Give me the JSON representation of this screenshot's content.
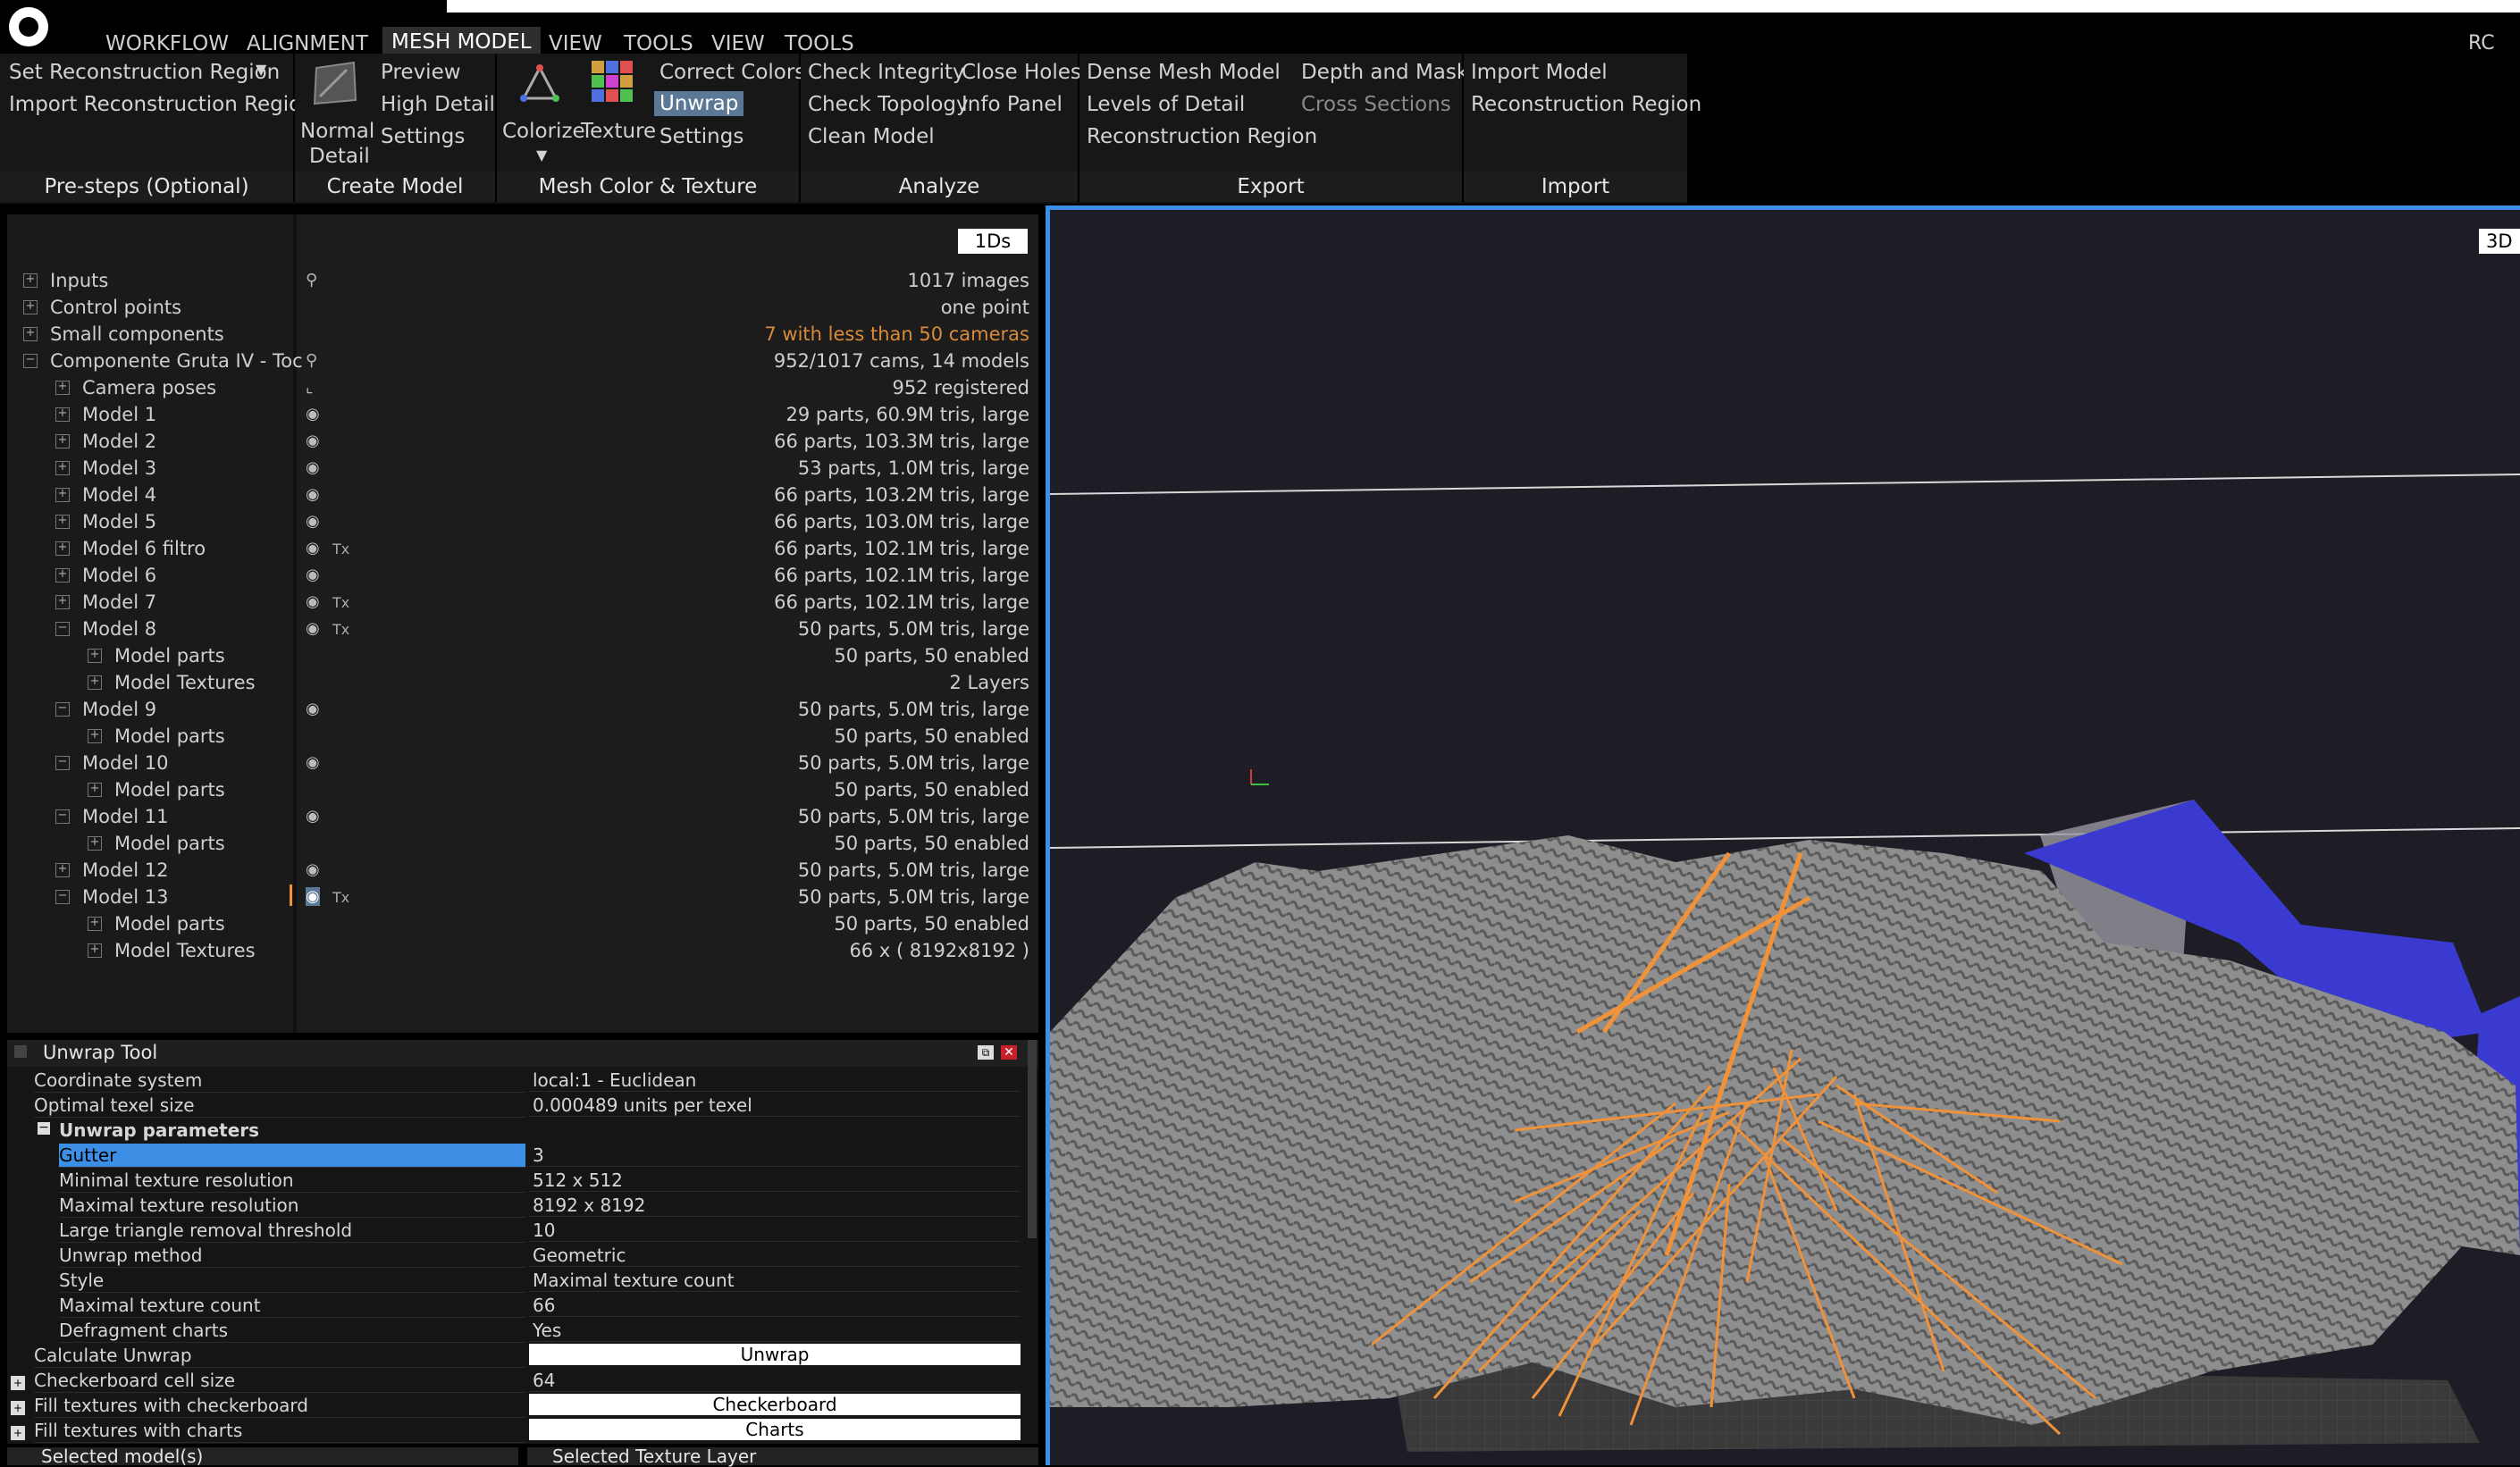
{
  "menubar": {
    "items": [
      "WORKFLOW",
      "ALIGNMENT",
      "MESH MODEL",
      "VIEW",
      "TOOLS",
      "VIEW",
      "TOOLS"
    ],
    "active": "MESH MODEL",
    "right_label": "RC"
  },
  "ribbon": {
    "presteps": {
      "line1": "Set Reconstruction Region",
      "line2": "Import Reconstruction Region",
      "footer": "Pre-steps (Optional)"
    },
    "create": {
      "normal": "Normal",
      "detail": "Detail",
      "preview": "Preview",
      "high_detail": "High Detail",
      "settings": "Settings",
      "footer": "Create Model"
    },
    "color": {
      "colorize": "Colorize",
      "texture": "Texture",
      "correct_colors": "Correct Colors",
      "unwrap": "Unwrap",
      "settings": "Settings",
      "footer": "Mesh Color & Texture"
    },
    "analyze": {
      "check_integrity": "Check Integrity",
      "close_holes": "Close Holes",
      "check_topology": "Check Topology",
      "info_panel": "Info Panel",
      "clean_model": "Clean Model",
      "footer": "Analyze"
    },
    "export": {
      "dense_mesh": "Dense Mesh Model",
      "depth_mask": "Depth and Mask",
      "lod": "Levels of Detail",
      "cross_sections": "Cross Sections",
      "recon_region": "Reconstruction Region",
      "footer": "Export"
    },
    "import": {
      "import_model": "Import Model",
      "recon_region": "Reconstruction Region",
      "footer": "Import"
    }
  },
  "tree": {
    "view_button": "1Ds",
    "rows": [
      {
        "label": "Inputs",
        "value": "1017 images"
      },
      {
        "label": "Control points",
        "value": "one point"
      },
      {
        "label": "Small components",
        "value": "7 with less than 50 cameras"
      },
      {
        "label": "Componente Gruta IV  - Toc",
        "value": "952/1017 cams, 14 models"
      },
      {
        "label": "Camera poses",
        "value": "952 registered"
      },
      {
        "label": "Model 1",
        "value": "29 parts, 60.9M tris, large"
      },
      {
        "label": "Model 2",
        "value": "66 parts, 103.3M tris, large"
      },
      {
        "label": "Model 3",
        "value": "53 parts, 1.0M tris, large"
      },
      {
        "label": "Model 4",
        "value": "66 parts, 103.2M tris, large"
      },
      {
        "label": "Model 5",
        "value": "66 parts, 103.0M tris, large"
      },
      {
        "label": "Model 6 filtro",
        "value": "66 parts, 102.1M tris, large"
      },
      {
        "label": "Model 6",
        "value": "66 parts, 102.1M tris, large"
      },
      {
        "label": "Model 7",
        "value": "66 parts, 102.1M tris, large"
      },
      {
        "label": "Model 8",
        "value": "50 parts, 5.0M tris, large"
      },
      {
        "label": "Model parts",
        "value": "50 parts, 50 enabled"
      },
      {
        "label": "Model Textures",
        "value": "2 Layers"
      },
      {
        "label": "Model 9",
        "value": "50 parts, 5.0M tris, large"
      },
      {
        "label": "Model parts",
        "value": "50 parts, 50 enabled"
      },
      {
        "label": "Model 10",
        "value": "50 parts, 5.0M tris, large"
      },
      {
        "label": "Model parts",
        "value": "50 parts, 50 enabled"
      },
      {
        "label": "Model 11",
        "value": "50 parts, 5.0M tris, large"
      },
      {
        "label": "Model parts",
        "value": "50 parts, 50 enabled"
      },
      {
        "label": "Model 12",
        "value": "50 parts, 5.0M tris, large"
      },
      {
        "label": "Model 13",
        "value": "50 parts, 5.0M tris, large"
      },
      {
        "label": "Model parts",
        "value": "50 parts, 50 enabled"
      },
      {
        "label": "Model Textures",
        "value": "66 x ( 8192x8192 )"
      }
    ],
    "tx_glyph": "Tx"
  },
  "unwrap_tool": {
    "title": "Unwrap Tool",
    "coord_label": "Coordinate system",
    "coord_value": "local:1 - Euclidean",
    "texel_label": "Optimal texel size",
    "texel_value": "0.000489 units per texel",
    "params_header": "Unwrap parameters",
    "gutter_label": "Gutter",
    "gutter_value": "3",
    "min_res_label": "Minimal texture resolution",
    "min_res_value": "512 x 512",
    "max_res_label": "Maximal texture resolution",
    "max_res_value": "8192 x 8192",
    "large_tri_label": "Large triangle removal threshold",
    "large_tri_value": "10",
    "method_label": "Unwrap method",
    "method_value": "Geometric",
    "style_label": "Style",
    "style_value": "Maximal texture count",
    "max_count_label": "Maximal texture count",
    "max_count_value": "66",
    "defrag_label": "Defragment charts",
    "defrag_value": "Yes",
    "calc_label": "Calculate Unwrap",
    "calc_button": "Unwrap",
    "cell_label": "Checkerboard cell size",
    "cell_value": "64",
    "fill_checker_label": "Fill textures with checkerboard",
    "fill_checker_button": "Checkerboard",
    "fill_charts_label": "Fill textures with charts",
    "fill_charts_button": "Charts"
  },
  "bottom_tabs": {
    "left": "Selected model(s)",
    "right": "Selected Texture Layer"
  },
  "viewport": {
    "view_button": "3D"
  },
  "colors": {
    "accent": "#3d8fe6",
    "camera_rays": "#f0923a",
    "mesh": "#8c8c8c",
    "region": "#3a3ad0"
  }
}
